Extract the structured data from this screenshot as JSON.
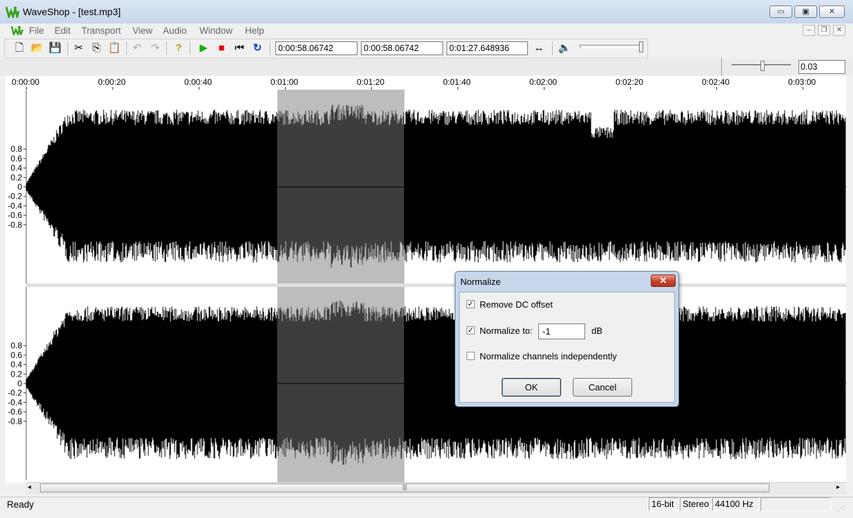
{
  "window": {
    "title": "WaveShop - [test.mp3]"
  },
  "menu": {
    "items": [
      "File",
      "Edit",
      "Transport",
      "View",
      "Audio",
      "Window",
      "Help"
    ]
  },
  "toolbar": {
    "icons": [
      "new-file-icon",
      "open-folder-icon",
      "save-icon",
      "cut-icon",
      "copy-icon",
      "paste-icon",
      "undo-icon",
      "redo-icon",
      "help-icon",
      "play-icon",
      "stop-icon",
      "rewind-icon",
      "loop-icon"
    ],
    "time_fields": [
      "0:00:58.06742",
      "0:00:58.06742",
      "0:01:27.648936"
    ],
    "volume_icon": "speaker-icon"
  },
  "zoom": {
    "value": "0.03"
  },
  "ruler": {
    "labels": [
      "0:00:00",
      "0:00:20",
      "0:00:40",
      "0:01:00",
      "0:01:20",
      "0:01:40",
      "0:02:00",
      "0:02:20",
      "0:02:40",
      "0:03:00"
    ]
  },
  "channels": {
    "axis_labels": [
      "0.8",
      "0.6",
      "0.4",
      "0.2",
      "0",
      "-0.2",
      "-0.4",
      "-0.6",
      "-0.8"
    ],
    "selection": {
      "start": "0:00:58.06742",
      "end": "0:01:27.648936"
    }
  },
  "status": {
    "text": "Ready",
    "bit_depth": "16-bit",
    "channels": "Stereo",
    "sample_rate": "44100 Hz"
  },
  "dialog": {
    "title": "Normalize",
    "remove_dc": {
      "label": "Remove DC offset",
      "checked": true
    },
    "normalize_to": {
      "label": "Normalize to:",
      "checked": true,
      "value": "-1",
      "unit": "dB"
    },
    "independent": {
      "label": "Normalize channels independently",
      "checked": false
    },
    "ok_label": "OK",
    "cancel_label": "Cancel",
    "close_glyph": "✕"
  },
  "colors": {
    "selection": "#bdbdbd",
    "selection_wave": "#3d3d3d",
    "wave": "#000000"
  }
}
